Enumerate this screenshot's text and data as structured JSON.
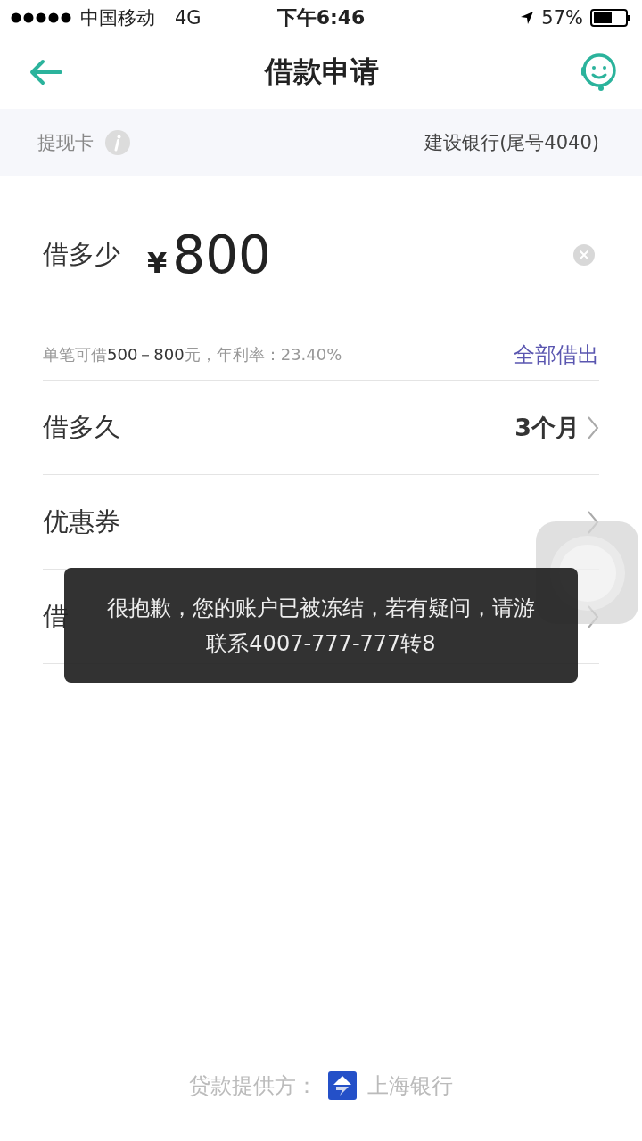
{
  "status_bar": {
    "carrier": "中国移动",
    "network": "4G",
    "time": "下午6:46",
    "battery": "57%"
  },
  "nav": {
    "title": "借款申请"
  },
  "card_row": {
    "label": "提现卡",
    "value": "建设银行(尾号4040)"
  },
  "amount": {
    "label": "借多少",
    "currency": "¥",
    "value": "800",
    "hint": [
      {
        "text": "单笔可借",
        "emphasis": false
      },
      {
        "text": "500－800",
        "emphasis": true
      },
      {
        "text": "元，年利率：23.40%",
        "emphasis": false
      }
    ],
    "action": "全部借出"
  },
  "rows": [
    {
      "label": "借多久",
      "value": "3个月"
    },
    {
      "label": "优惠券"
    },
    {
      "label": "借"
    }
  ],
  "toast": {
    "lines": [
      "很抱歉，您的账户已被冻结，若有疑问，请游",
      "联系4007-777-777转8"
    ]
  },
  "footer": {
    "label": "贷款提供方：",
    "bank": "上海银行"
  }
}
